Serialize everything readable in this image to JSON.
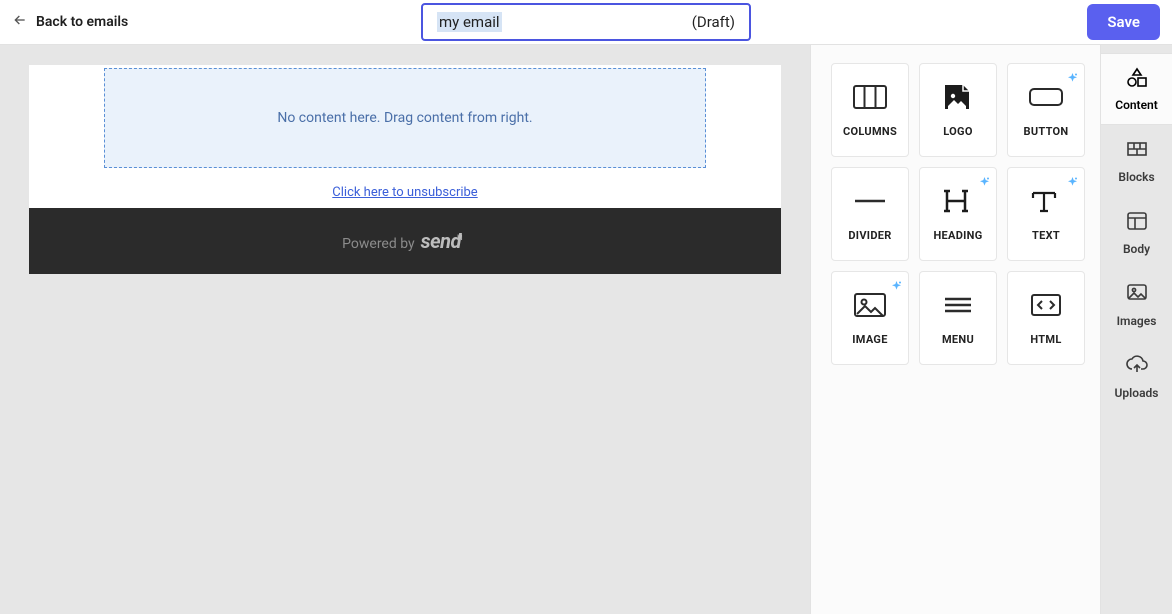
{
  "header": {
    "back_label": "Back to emails",
    "title_value": "my email",
    "title_status": "(Draft)",
    "save_label": "Save"
  },
  "canvas": {
    "dropzone_text": "No content here. Drag content from right.",
    "unsubscribe_text": "Click here to unsubscribe",
    "powered_by": "Powered by",
    "brand": "send"
  },
  "blocks": {
    "items": [
      {
        "label": "COLUMNS",
        "icon": "columns-icon",
        "sparkle": false
      },
      {
        "label": "LOGO",
        "icon": "logo-icon",
        "sparkle": false
      },
      {
        "label": "BUTTON",
        "icon": "button-icon",
        "sparkle": true
      },
      {
        "label": "DIVIDER",
        "icon": "divider-icon",
        "sparkle": false
      },
      {
        "label": "HEADING",
        "icon": "heading-icon",
        "sparkle": true
      },
      {
        "label": "TEXT",
        "icon": "text-icon",
        "sparkle": true
      },
      {
        "label": "IMAGE",
        "icon": "image-icon",
        "sparkle": true
      },
      {
        "label": "MENU",
        "icon": "menu-icon",
        "sparkle": false
      },
      {
        "label": "HTML",
        "icon": "html-icon",
        "sparkle": false
      }
    ]
  },
  "side_tabs": {
    "items": [
      {
        "label": "Content",
        "icon": "shapes-icon",
        "active": true
      },
      {
        "label": "Blocks",
        "icon": "bricks-icon",
        "active": false
      },
      {
        "label": "Body",
        "icon": "layout-icon",
        "active": false
      },
      {
        "label": "Images",
        "icon": "images-icon",
        "active": false
      },
      {
        "label": "Uploads",
        "icon": "upload-icon",
        "active": false
      }
    ]
  }
}
